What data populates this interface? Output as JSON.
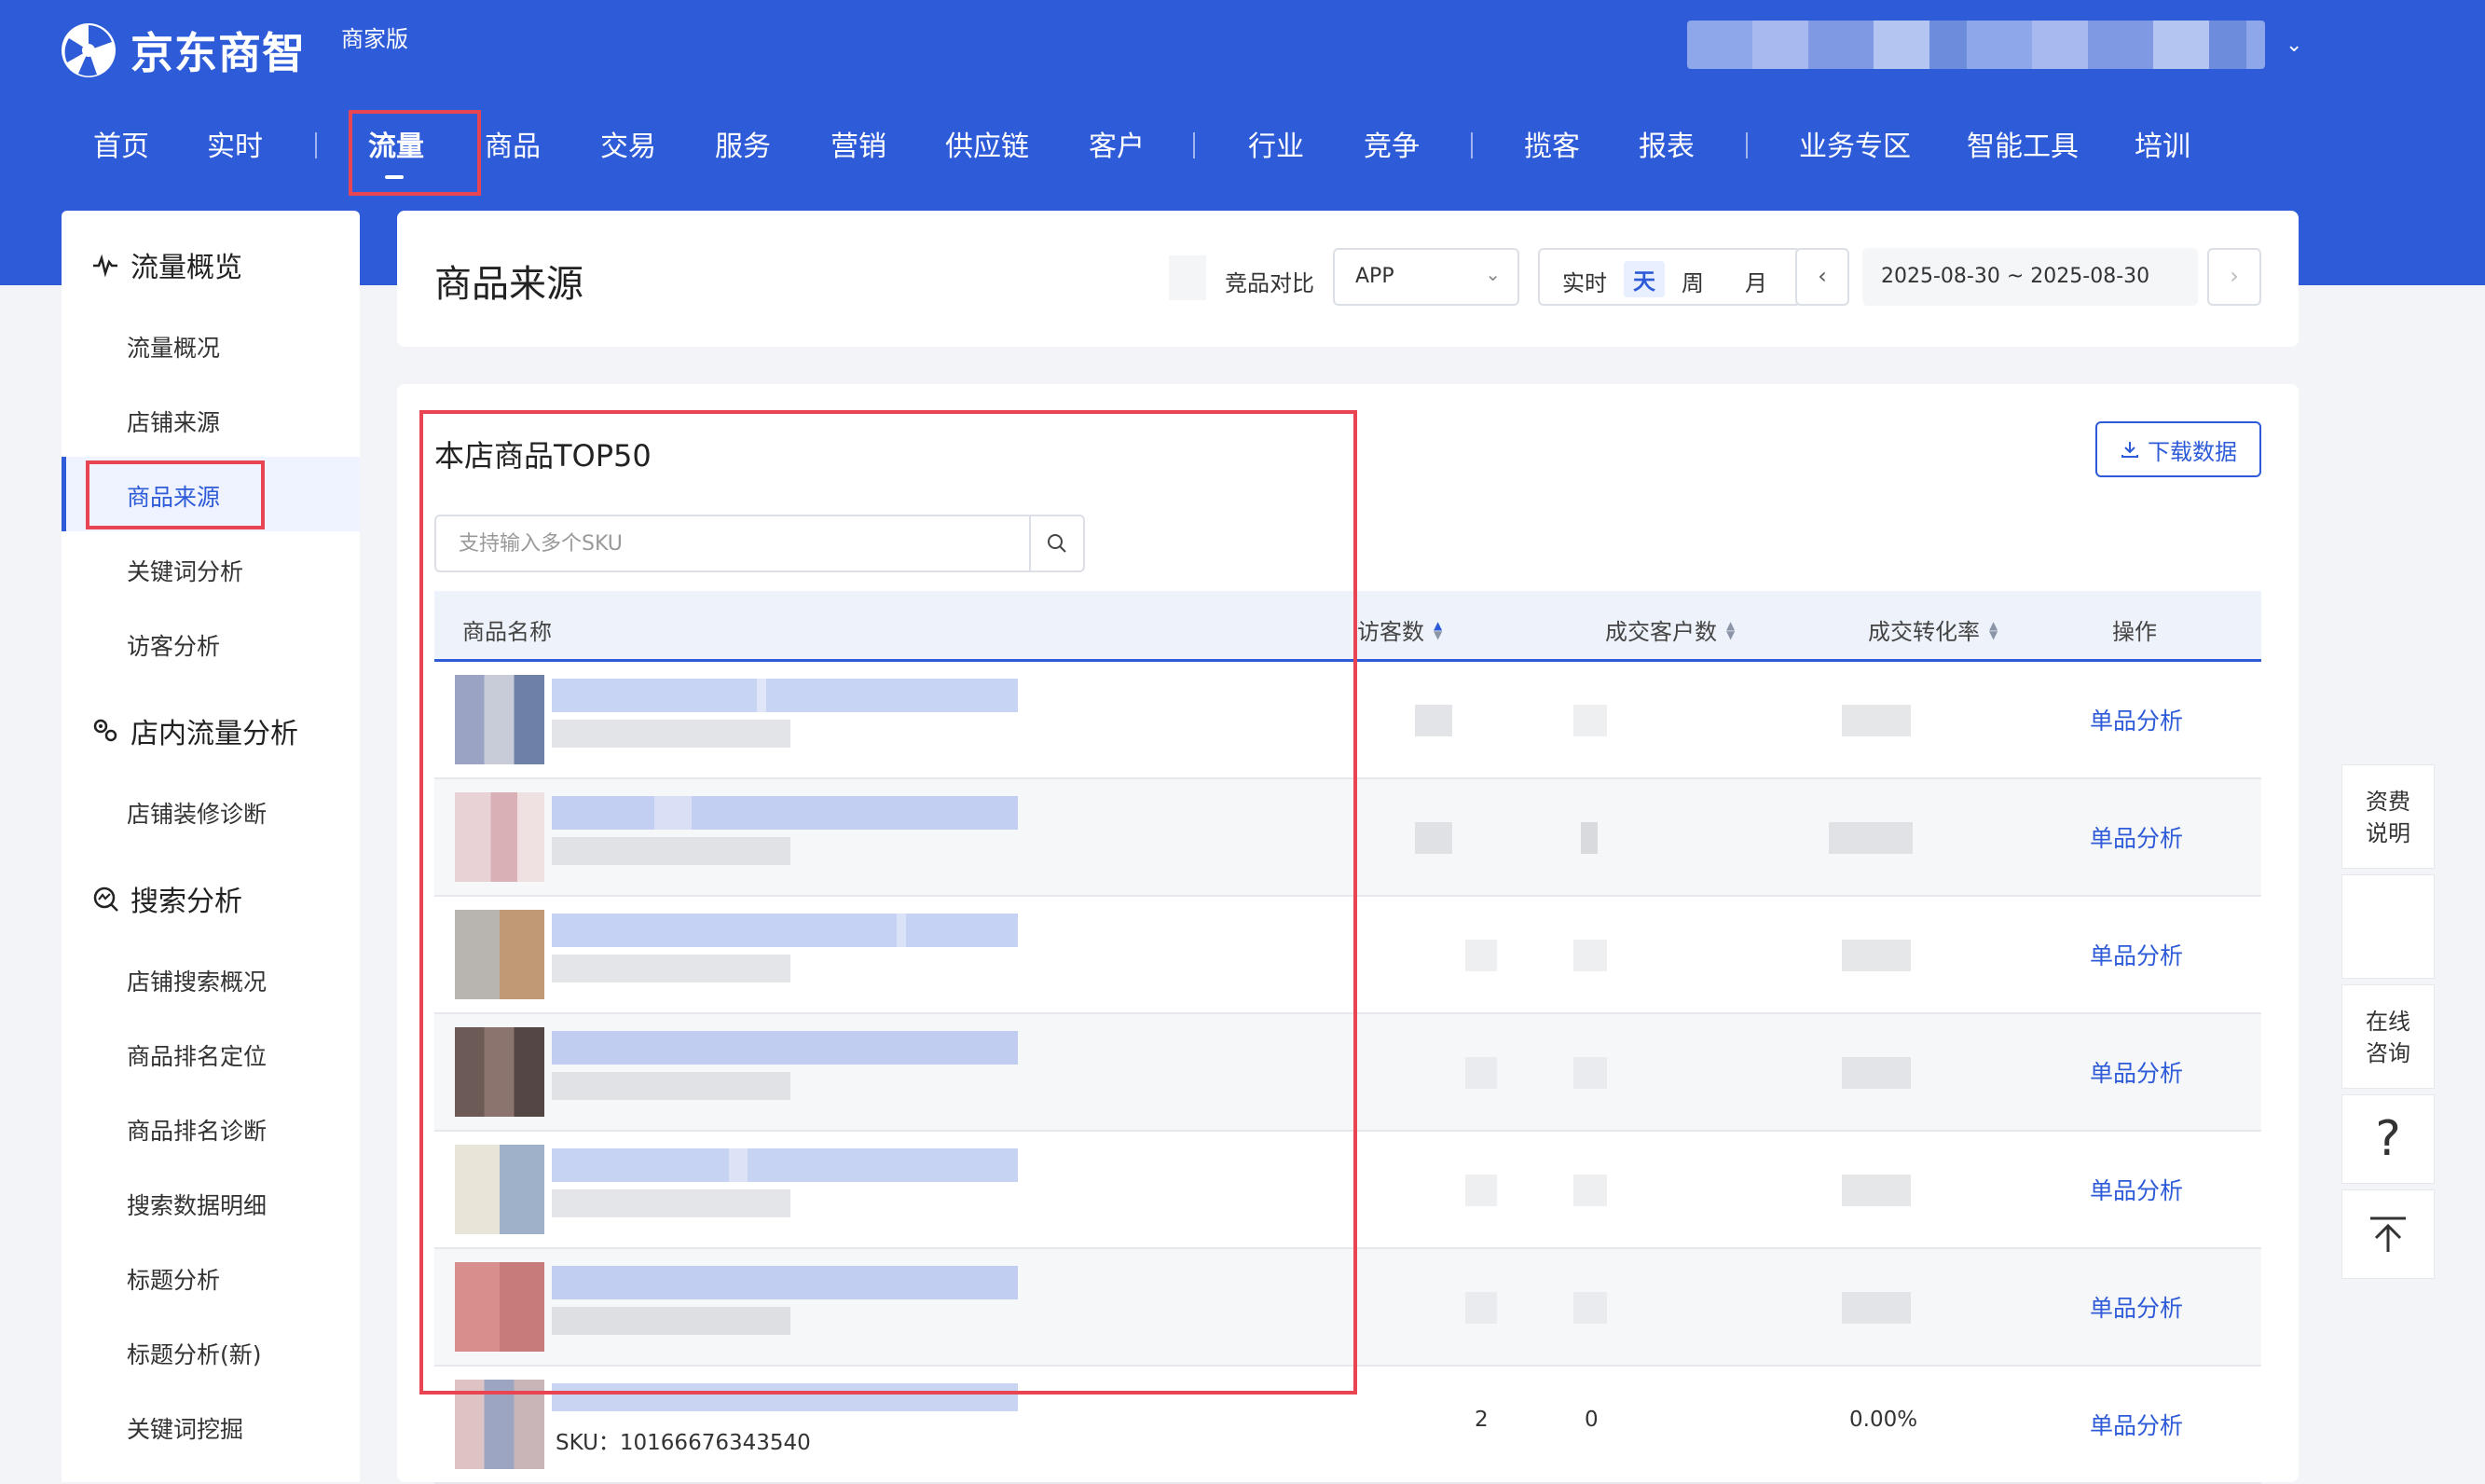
{
  "brand": {
    "name": "京东商智",
    "edition": "商家版"
  },
  "top_nav": [
    {
      "label": "首页"
    },
    {
      "label": "实时"
    },
    {
      "label": "流量"
    },
    {
      "label": "商品"
    },
    {
      "label": "交易"
    },
    {
      "label": "服务"
    },
    {
      "label": "营销"
    },
    {
      "label": "供应链"
    },
    {
      "label": "客户"
    },
    {
      "label": "行业"
    },
    {
      "label": "竞争"
    },
    {
      "label": "揽客"
    },
    {
      "label": "报表"
    },
    {
      "label": "业务专区"
    },
    {
      "label": "智能工具"
    },
    {
      "label": "培训"
    }
  ],
  "active_nav": "流量",
  "sidebar": {
    "groups": [
      {
        "title": "流量概览",
        "icon": "pulse-icon",
        "items": [
          "流量概况",
          "店铺来源",
          "商品来源",
          "关键词分析",
          "访客分析"
        ]
      },
      {
        "title": "店内流量分析",
        "icon": "flow-icon",
        "items": [
          "店铺装修诊断"
        ]
      },
      {
        "title": "搜索分析",
        "icon": "search-trend-icon",
        "items": [
          "店铺搜索概况",
          "商品排名定位",
          "商品排名诊断",
          "搜索数据明细",
          "标题分析",
          "标题分析(新)",
          "关键词挖掘"
        ]
      }
    ],
    "active_item": "商品来源"
  },
  "header_bar": {
    "page_title": "商品来源",
    "compare_label": "竞品对比",
    "platform_select": "APP",
    "period_options": [
      "实时",
      "天",
      "周",
      "月"
    ],
    "active_period": "天",
    "date_range": "2025-08-30 ~ 2025-08-30",
    "prev_icon": "chevron-left-icon",
    "next_icon": "chevron-right-icon"
  },
  "top50": {
    "title": "本店商品TOP50",
    "download_label": "下载数据",
    "search_placeholder": "支持输入多个SKU",
    "columns": [
      "商品名称",
      "访客数",
      "成交客户数",
      "成交转化率",
      "操作"
    ],
    "rows": [
      {
        "action": "单品分析"
      },
      {
        "action": "单品分析"
      },
      {
        "action": "单品分析"
      },
      {
        "action": "单品分析"
      },
      {
        "action": "单品分析"
      },
      {
        "action": "单品分析"
      },
      {
        "action": "单品分析",
        "sku": "SKU：10166676343540",
        "visitors": "2",
        "buyers": "0",
        "conversion": "0.00%"
      }
    ]
  },
  "float_panel": {
    "fee_label": "资费\n说明",
    "consult_label": "在线\n咨询",
    "help_icon": "question-icon",
    "top_icon": "back-to-top-icon"
  },
  "colors": {
    "brand_blue": "#2e5bd8",
    "highlight_red": "#e94452"
  }
}
